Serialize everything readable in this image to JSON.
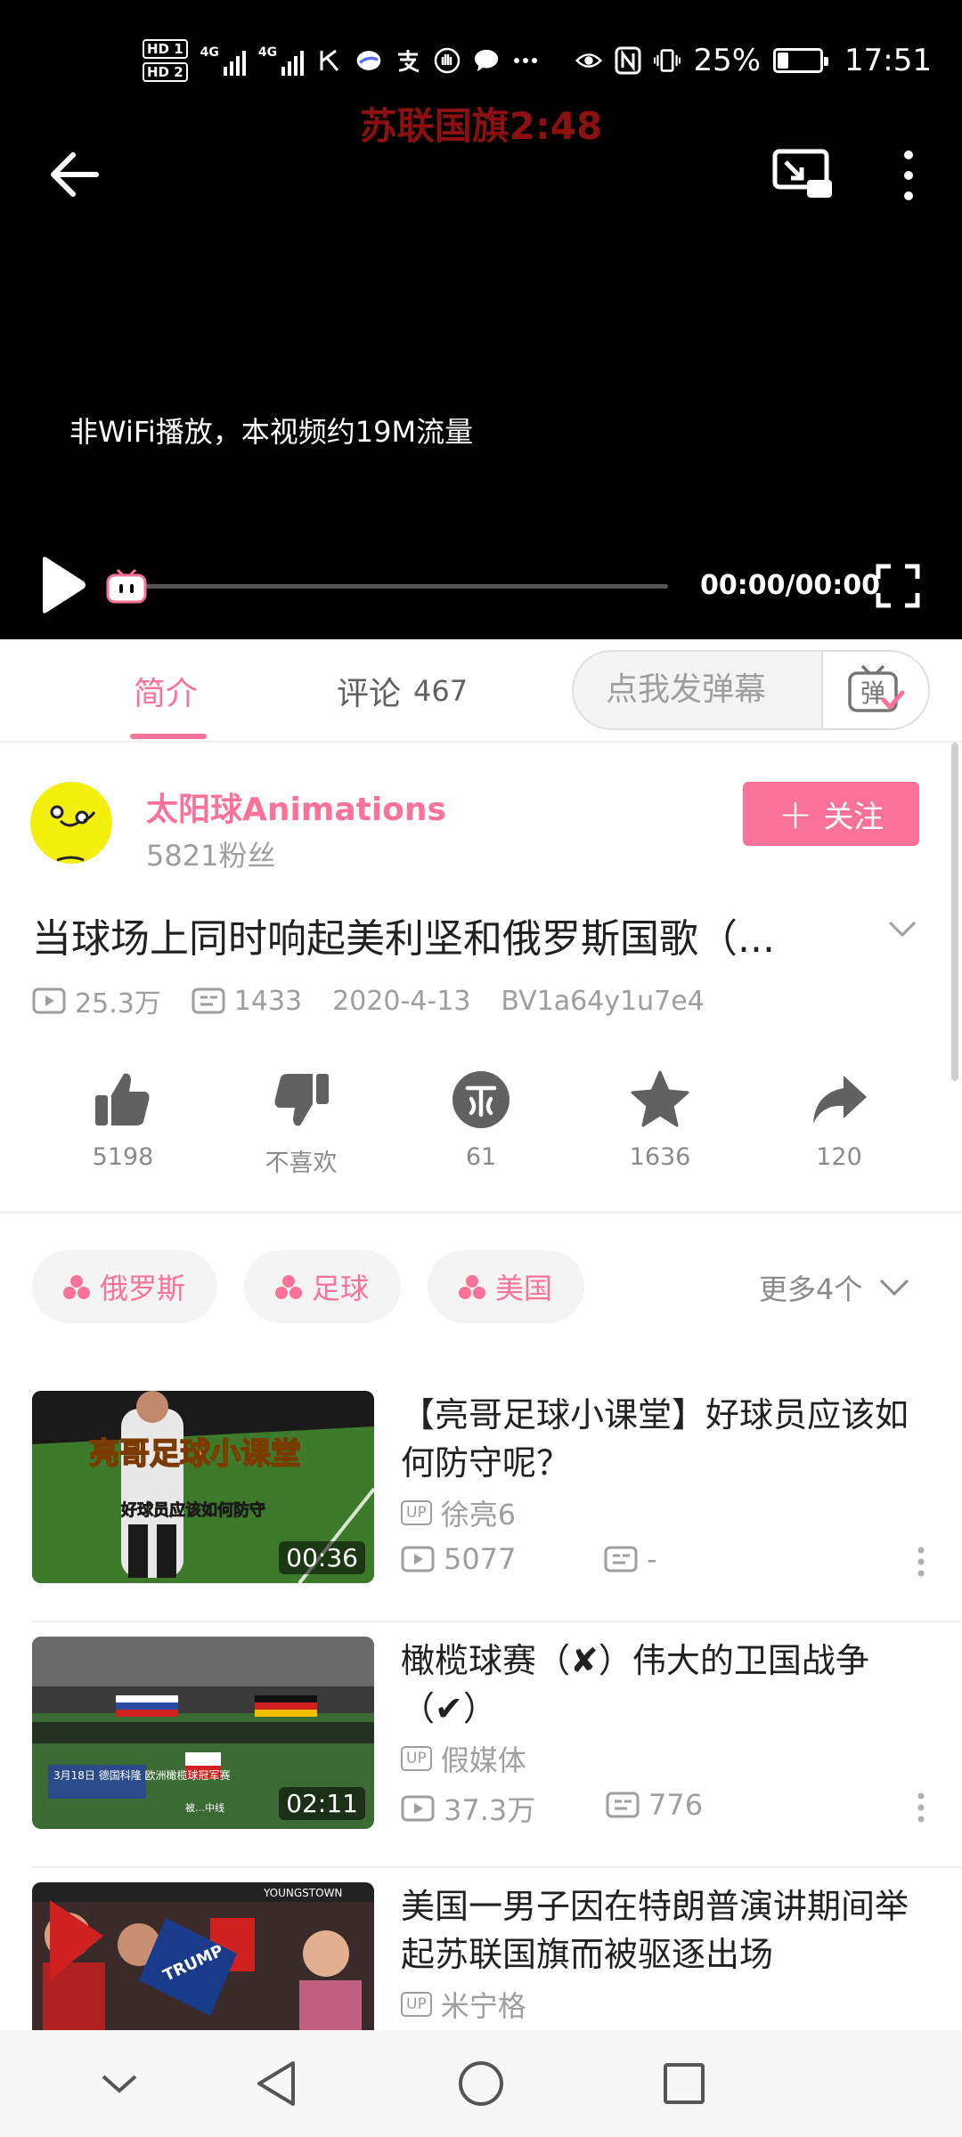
{
  "status_bar": {
    "hd1": "HD 1",
    "hd2": "HD 2",
    "net1": "4G",
    "net2": "4G",
    "battery_text": "25%",
    "battery_level": 0.25,
    "time": "17:51",
    "icons": [
      "k-icon",
      "feather-icon",
      "alipay-icon",
      "hand-icon",
      "message-icon",
      "more-dots-icon",
      "eye-icon",
      "nfc-icon",
      "vibrate-icon"
    ]
  },
  "player": {
    "title": "苏联国旗2:48",
    "flow_notice": "非WiFi播放，本视频约19M流量",
    "time": "00:00/00:00",
    "progress": 0
  },
  "tabs": {
    "intro": "简介",
    "comments_label": "评论",
    "comments_count": "467",
    "danmaku_placeholder": "点我发弹幕",
    "danmaku_icon_char": "弹"
  },
  "uploader": {
    "name": "太阳球Animations",
    "fans": "5821粉丝",
    "follow_label": "关注"
  },
  "video": {
    "title": "当球场上同时响起美利坚和俄罗斯国歌（...",
    "views": "25.3万",
    "danmaku": "1433",
    "date": "2020-4-13",
    "bvid": "BV1a64y1u7e4"
  },
  "actions": {
    "like": "5198",
    "dislike": "不喜欢",
    "coin": "61",
    "favorite": "1636",
    "share": "120"
  },
  "tags": {
    "items": [
      "俄罗斯",
      "足球",
      "美国"
    ],
    "more": "更多4个"
  },
  "recommendations": [
    {
      "title": "【亮哥足球小课堂】好球员应该如何防守呢？",
      "uploader": "徐亮6",
      "views": "5077",
      "danmaku": "-",
      "duration": "00:36",
      "thumb_caption": "亮哥足球小课堂",
      "thumb_subcaption": "好球员应该如何防守"
    },
    {
      "title": "橄榄球赛（✘）伟大的卫国战争（✔）",
      "uploader": "假媒体",
      "views": "37.3万",
      "danmaku": "776",
      "duration": "02:11",
      "thumb_caption": "3月18日 德国科隆 欧洲橄榄球冠军赛",
      "thumb_subcaption": "被…中线"
    },
    {
      "title": "美国一男子因在特朗普演讲期间举起苏联国旗而被驱逐出场",
      "uploader": "米宁格",
      "thumb_caption": "YOUNGSTOWN",
      "thumb_sign": "TRUMP"
    }
  ],
  "up_badge": "UP",
  "colors": {
    "accent": "#fb7299",
    "player_bg": "#000000",
    "title_red": "#8b1010"
  }
}
